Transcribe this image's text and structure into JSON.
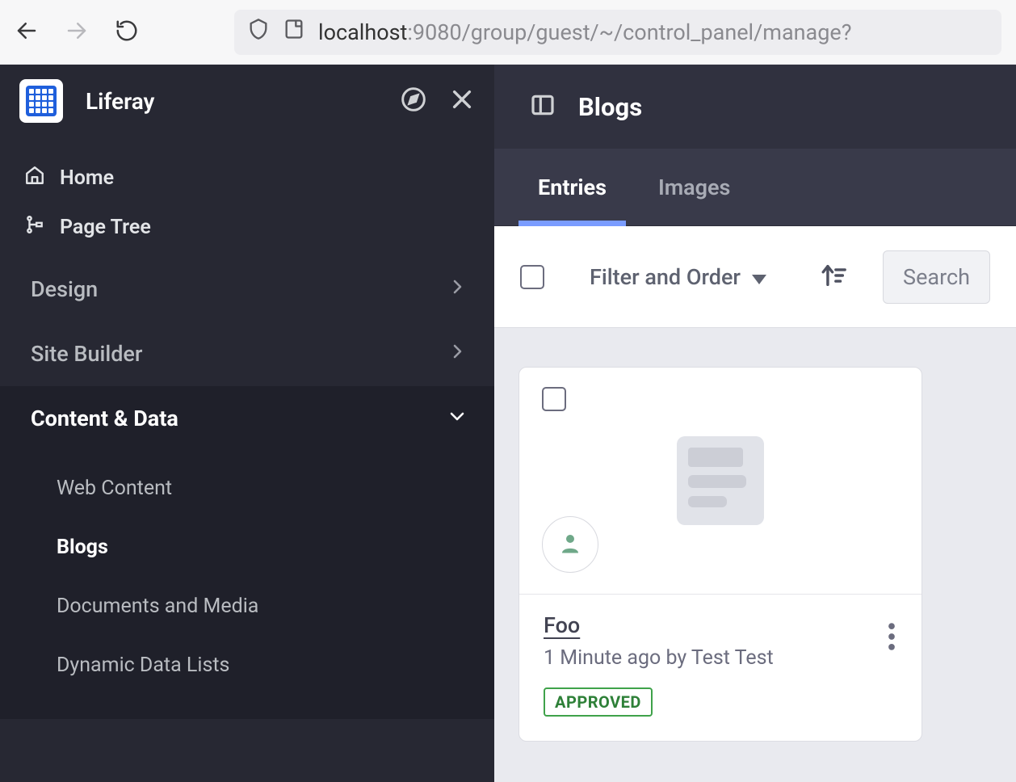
{
  "browser": {
    "url_prefix": "localhost",
    "url_suffix": ":9080/group/guest/~/control_panel/manage?"
  },
  "sidebar": {
    "brand": "Liferay",
    "top_links": [
      {
        "label": "Home"
      },
      {
        "label": "Page Tree"
      }
    ],
    "sections": [
      {
        "label": "Design",
        "expanded": false
      },
      {
        "label": "Site Builder",
        "expanded": false
      },
      {
        "label": "Content & Data",
        "expanded": true
      }
    ],
    "content_data_items": [
      {
        "label": "Web Content"
      },
      {
        "label": "Blogs"
      },
      {
        "label": "Documents and Media"
      },
      {
        "label": "Dynamic Data Lists"
      }
    ]
  },
  "main": {
    "title": "Blogs",
    "tabs": [
      {
        "label": "Entries"
      },
      {
        "label": "Images"
      }
    ],
    "toolbar": {
      "filter_label": "Filter and Order",
      "search_placeholder": "Search"
    },
    "entries": [
      {
        "title": "Foo",
        "meta": "1 Minute ago by Test Test",
        "status": "APPROVED"
      }
    ]
  }
}
